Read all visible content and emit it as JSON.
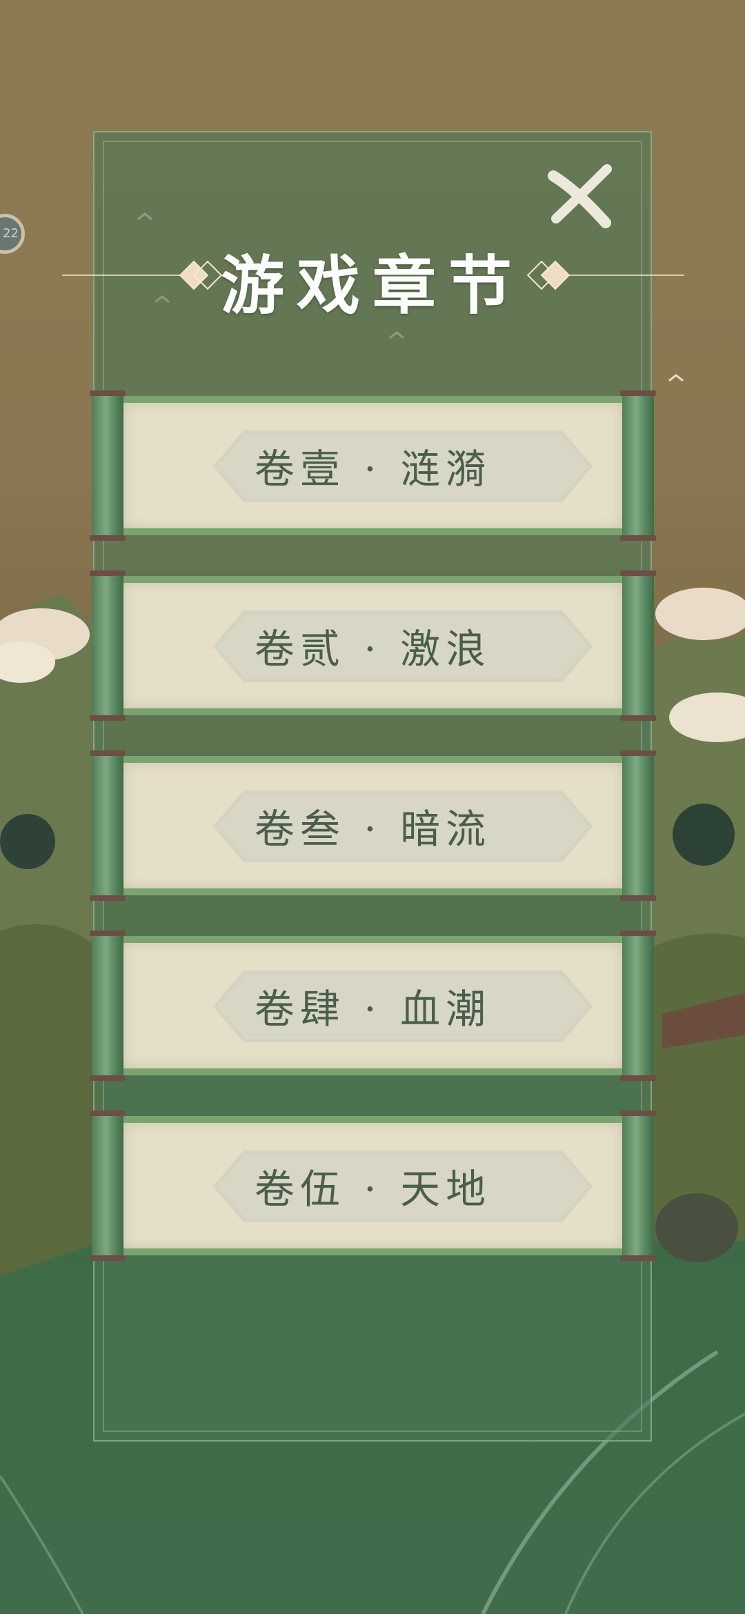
{
  "side_badge": {
    "text": "22"
  },
  "header": {
    "title": "游戏章节",
    "close_icon": "close-brush-x-icon"
  },
  "chapters": [
    {
      "label": "卷壹 · 涟漪"
    },
    {
      "label": "卷贰 · 激浪"
    },
    {
      "label": "卷叁 · 暗流"
    },
    {
      "label": "卷肆 · 血潮"
    },
    {
      "label": "卷伍 · 天地"
    }
  ],
  "colors": {
    "panel": "#4c7856",
    "paper": "#e6dfc8",
    "roller": "#6f9a72",
    "label": "#4a5e4c",
    "title": "#ffffff"
  }
}
